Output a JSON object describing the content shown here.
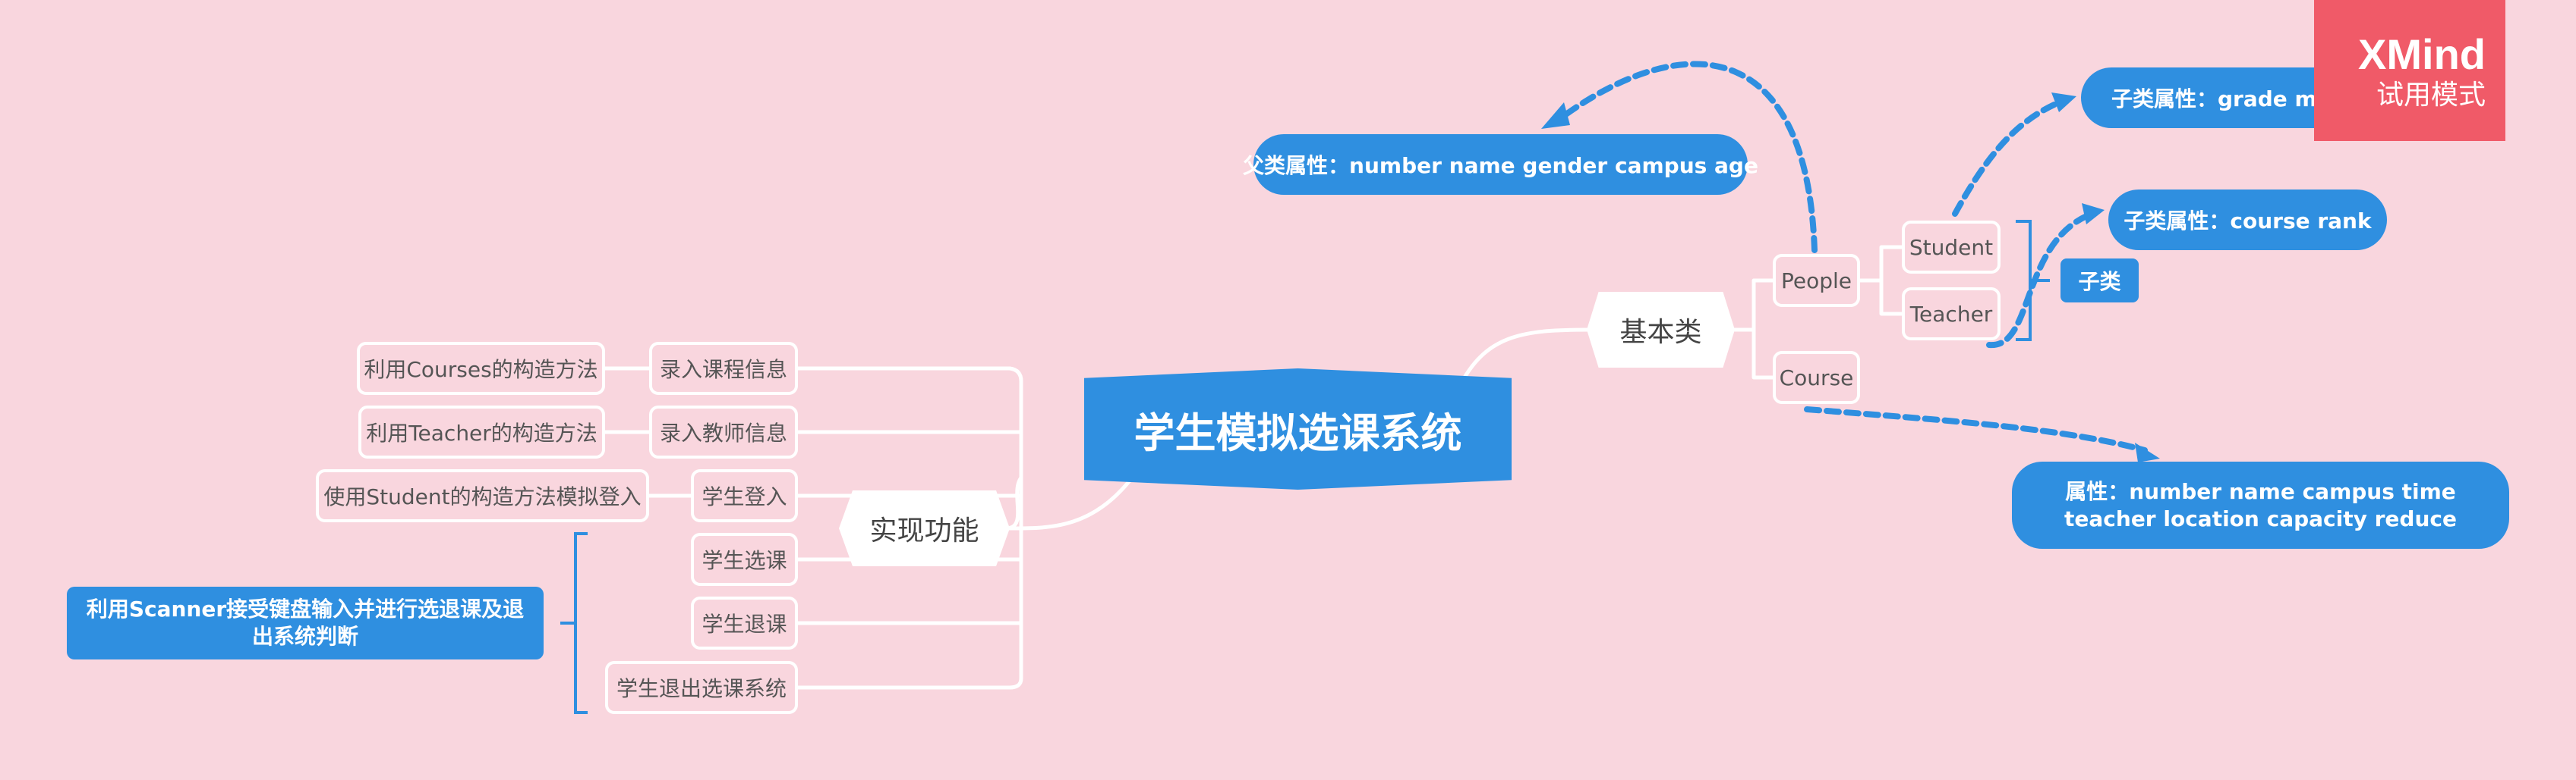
{
  "central": "学生模拟选课系统",
  "branches": {
    "impl": {
      "label": "实现功能",
      "items": {
        "enter_course": "录入课程信息",
        "enter_teacher": "录入教师信息",
        "student_login": "学生登入",
        "student_select": "学生选课",
        "student_drop": "学生退课",
        "student_exit": "学生退出选课系统"
      },
      "details": {
        "courses_ctor": "利用Courses的构造方法",
        "teacher_ctor": "利用Teacher的构造方法",
        "student_ctor": "使用Student的构造方法模拟登入"
      },
      "summary": "利用Scanner接受键盘输入并进行选退课及退出系统判断"
    },
    "basic": {
      "label": "基本类",
      "people": "People",
      "student": "Student",
      "teacher": "Teacher",
      "course": "Course",
      "subclass_summary": "子类",
      "parent_attr": "父类属性：number name gender campus age",
      "student_attr": "子类属性：grade major course",
      "teacher_attr": "子类属性：course rank",
      "course_attr": "属性：number name campus time teacher location capacity reduce"
    }
  },
  "watermark": {
    "brand": "XMind",
    "mode": "试用模式"
  },
  "colors": {
    "background": "#f9d6de",
    "topic_blue": "#2f8fe0",
    "connector": "#ffffff",
    "watermark_red": "#f05a68"
  }
}
